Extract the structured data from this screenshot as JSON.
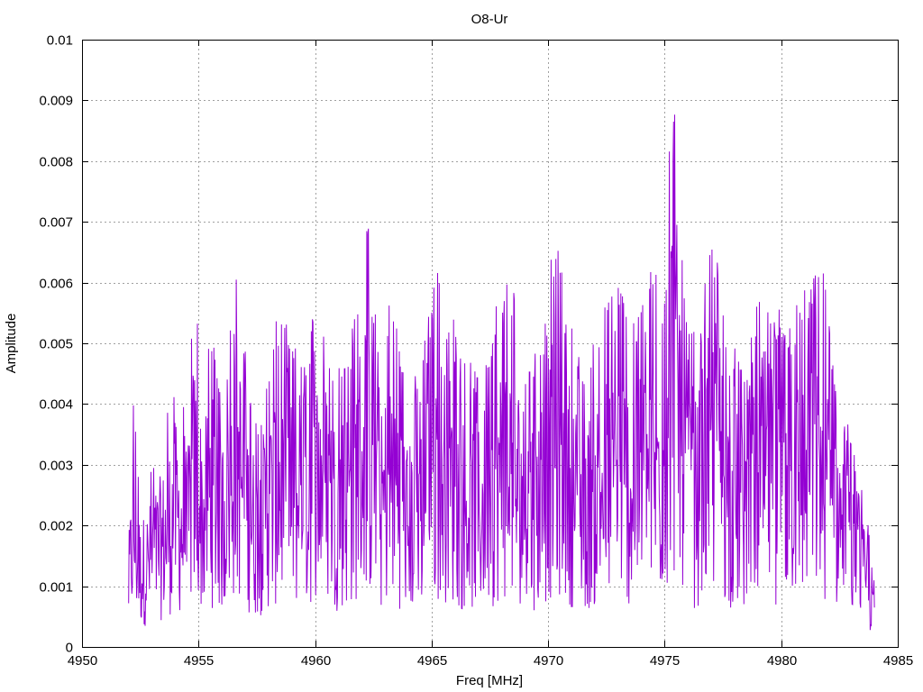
{
  "chart_data": {
    "type": "line",
    "title": "O8-Ur",
    "xlabel": "Freq [MHz]",
    "ylabel": "Amplitude",
    "xlim": [
      4950,
      4985
    ],
    "ylim": [
      0,
      0.01
    ],
    "x_ticks": [
      "4950",
      "4955",
      "4960",
      "4965",
      "4970",
      "4975",
      "4980",
      "4985"
    ],
    "y_ticks": [
      "0",
      "0.001",
      "0.002",
      "0.003",
      "0.004",
      "0.005",
      "0.006",
      "0.007",
      "0.008",
      "0.009",
      "0.01"
    ],
    "grid": true,
    "legend": "none",
    "series_color": "#9400d3",
    "series": [
      {
        "x_start": 4952.0,
        "x_end": 4984.0,
        "y_envelope": [
          [
            4952.0,
            0.0022
          ],
          [
            4952.2,
            0.0041
          ],
          [
            4952.5,
            0.0026
          ],
          [
            4953.0,
            0.0031
          ],
          [
            4953.5,
            0.0037
          ],
          [
            4954.0,
            0.0047
          ],
          [
            4954.5,
            0.0037
          ],
          [
            4954.8,
            0.0061
          ],
          [
            4955.2,
            0.0044
          ],
          [
            4955.5,
            0.0054
          ],
          [
            4956.0,
            0.0044
          ],
          [
            4956.7,
            0.0065
          ],
          [
            4957.0,
            0.0049
          ],
          [
            4957.5,
            0.0039
          ],
          [
            4958.0,
            0.0049
          ],
          [
            4958.5,
            0.0056
          ],
          [
            4959.0,
            0.0051
          ],
          [
            4959.5,
            0.0047
          ],
          [
            4960.2,
            0.0062
          ],
          [
            4960.8,
            0.0049
          ],
          [
            4961.5,
            0.0051
          ],
          [
            4962.2,
            0.0073
          ],
          [
            4962.8,
            0.0047
          ],
          [
            4963.3,
            0.0061
          ],
          [
            4964.0,
            0.0042
          ],
          [
            4964.5,
            0.0047
          ],
          [
            4965.2,
            0.0064
          ],
          [
            4965.7,
            0.0059
          ],
          [
            4966.3,
            0.0048
          ],
          [
            4967.0,
            0.0046
          ],
          [
            4967.5,
            0.0054
          ],
          [
            4968.3,
            0.0063
          ],
          [
            4969.0,
            0.0051
          ],
          [
            4969.5,
            0.0049
          ],
          [
            4970.3,
            0.0068
          ],
          [
            4971.0,
            0.0054
          ],
          [
            4971.5,
            0.0046
          ],
          [
            4972.3,
            0.0055
          ],
          [
            4973.0,
            0.0062
          ],
          [
            4973.5,
            0.0054
          ],
          [
            4974.5,
            0.0063
          ],
          [
            4975.0,
            0.0061
          ],
          [
            4975.3,
            0.0095
          ],
          [
            4975.8,
            0.0078
          ],
          [
            4976.3,
            0.0051
          ],
          [
            4977.2,
            0.0071
          ],
          [
            4977.8,
            0.0051
          ],
          [
            4978.5,
            0.0046
          ],
          [
            4979.2,
            0.0062
          ],
          [
            4979.8,
            0.0057
          ],
          [
            4980.5,
            0.0056
          ],
          [
            4981.2,
            0.0061
          ],
          [
            4981.8,
            0.0062
          ],
          [
            4982.5,
            0.0045
          ],
          [
            4983.0,
            0.0034
          ],
          [
            4983.5,
            0.0026
          ],
          [
            4984.0,
            0.0014
          ]
        ]
      }
    ]
  }
}
